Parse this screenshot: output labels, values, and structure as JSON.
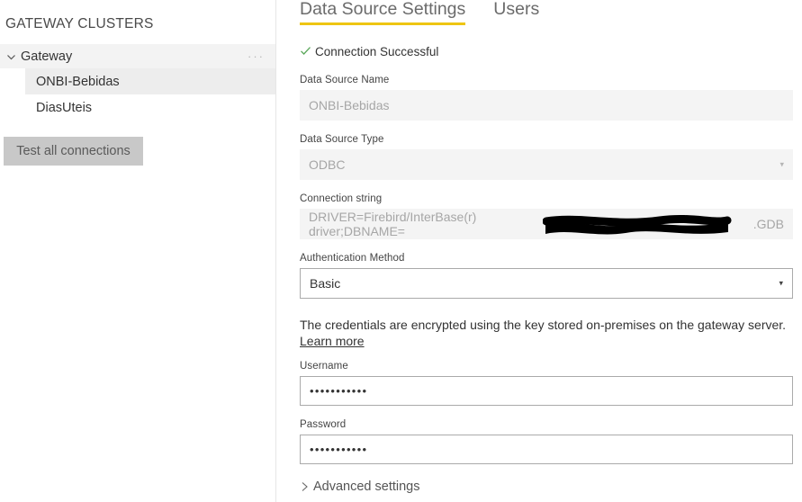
{
  "sidebar": {
    "heading": "GATEWAY CLUSTERS",
    "cluster": {
      "name": "Gateway",
      "chevron_icon": "chevron-down-icon",
      "more_menu": "···"
    },
    "data_sources": [
      {
        "label": "ONBI-Bebidas",
        "selected": true
      },
      {
        "label": "DiasUteis",
        "selected": false
      }
    ],
    "test_button": "Test all connections"
  },
  "main": {
    "tabs": [
      {
        "label": "Data Source Settings",
        "active": true
      },
      {
        "label": "Users",
        "active": false
      }
    ],
    "accent_color": "#eec512",
    "status": {
      "icon": "check-icon",
      "icon_color": "#5ba85b",
      "text": "Connection Successful"
    },
    "fields": {
      "data_source_name": {
        "label": "Data Source Name",
        "value": "ONBI-Bebidas"
      },
      "data_source_type": {
        "label": "Data Source Type",
        "value": "ODBC",
        "caret": "▾"
      },
      "connection_string": {
        "label": "Connection string",
        "value_prefix": "DRIVER=Firebird/InterBase(r) driver;DBNAME=",
        "value_suffix": ".GDB"
      },
      "authentication_method": {
        "label": "Authentication Method",
        "value": "Basic",
        "caret": "▾"
      },
      "username": {
        "label": "Username",
        "value": "•••••••••••"
      },
      "password": {
        "label": "Password",
        "value": "•••••••••••"
      }
    },
    "credential_note": {
      "text": "The credentials are encrypted using the key stored on-premises on the gateway server.",
      "link": "Learn more"
    },
    "advanced_settings": {
      "label": "Advanced settings",
      "chevron_icon": "chevron-right-icon"
    }
  }
}
